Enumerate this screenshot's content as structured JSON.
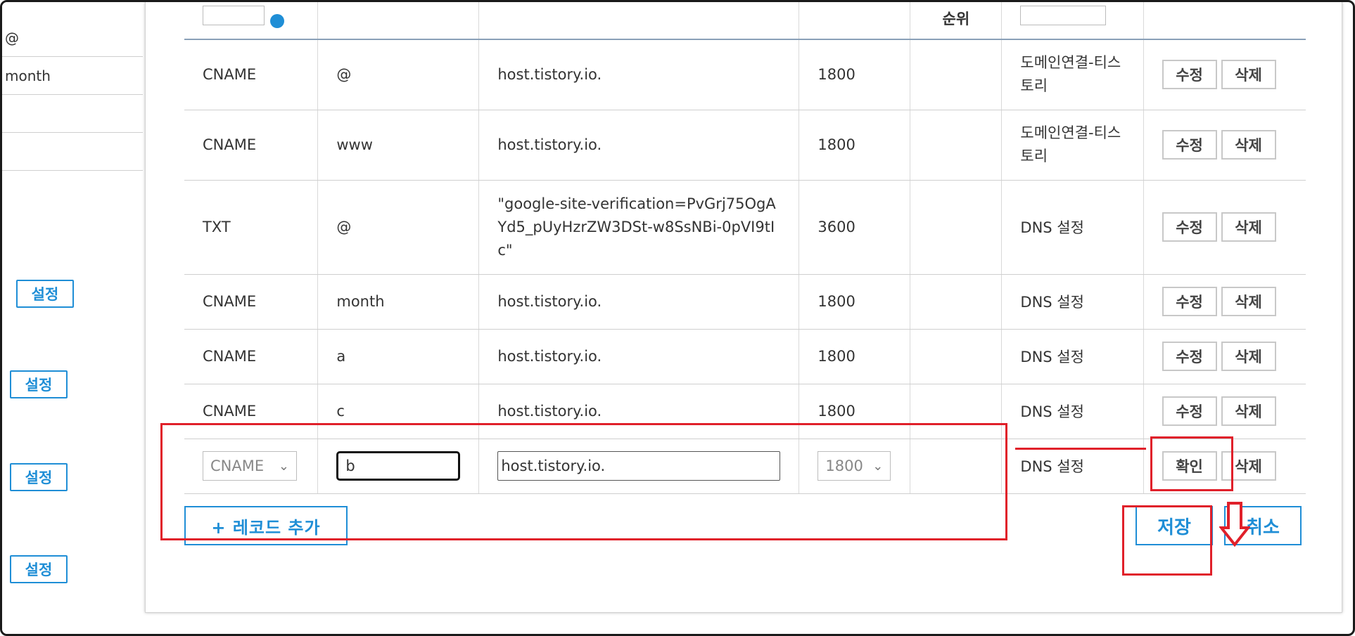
{
  "background_page": {
    "rows": [
      "@",
      "month",
      "",
      ""
    ],
    "settings_buttons": [
      "설정",
      "설정",
      "설정",
      "설정"
    ]
  },
  "table": {
    "header": {
      "sort_label": "순위"
    },
    "rows": [
      {
        "type": "CNAME",
        "name": "@",
        "value": "host.tistory.io.",
        "ttl": "1800",
        "memo": "도메인연결-티스토리",
        "edit": "수정",
        "delete": "삭제"
      },
      {
        "type": "CNAME",
        "name": "www",
        "value": "host.tistory.io.",
        "ttl": "1800",
        "memo": "도메인연결-티스토리",
        "edit": "수정",
        "delete": "삭제"
      },
      {
        "type": "TXT",
        "name": "@",
        "value": "\"google-site-verification=PvGrj75OgAYd5_pUyHzrZW3DSt-w8SsNBi-0pVI9tIc\"",
        "ttl": "3600",
        "memo": "DNS 설정",
        "edit": "수정",
        "delete": "삭제"
      },
      {
        "type": "CNAME",
        "name": "month",
        "value": "host.tistory.io.",
        "ttl": "1800",
        "memo": "DNS 설정",
        "edit": "수정",
        "delete": "삭제"
      },
      {
        "type": "CNAME",
        "name": "a",
        "value": "host.tistory.io.",
        "ttl": "1800",
        "memo": "DNS 설정",
        "edit": "수정",
        "delete": "삭제"
      },
      {
        "type": "CNAME",
        "name": "c",
        "value": "host.tistory.io.",
        "ttl": "1800",
        "memo": "DNS 설정",
        "edit": "수정",
        "delete": "삭제"
      }
    ],
    "edit_row": {
      "type": "CNAME",
      "name": "b",
      "value": "host.tistory.io.",
      "ttl": "1800",
      "memo": "DNS 설정",
      "confirm": "확인",
      "delete": "삭제"
    }
  },
  "footer": {
    "add_record": "+ 레코드 추가",
    "save": "저장",
    "cancel": "취소"
  },
  "colors": {
    "accent": "#1f8ed6",
    "annotation": "#e0202a"
  }
}
